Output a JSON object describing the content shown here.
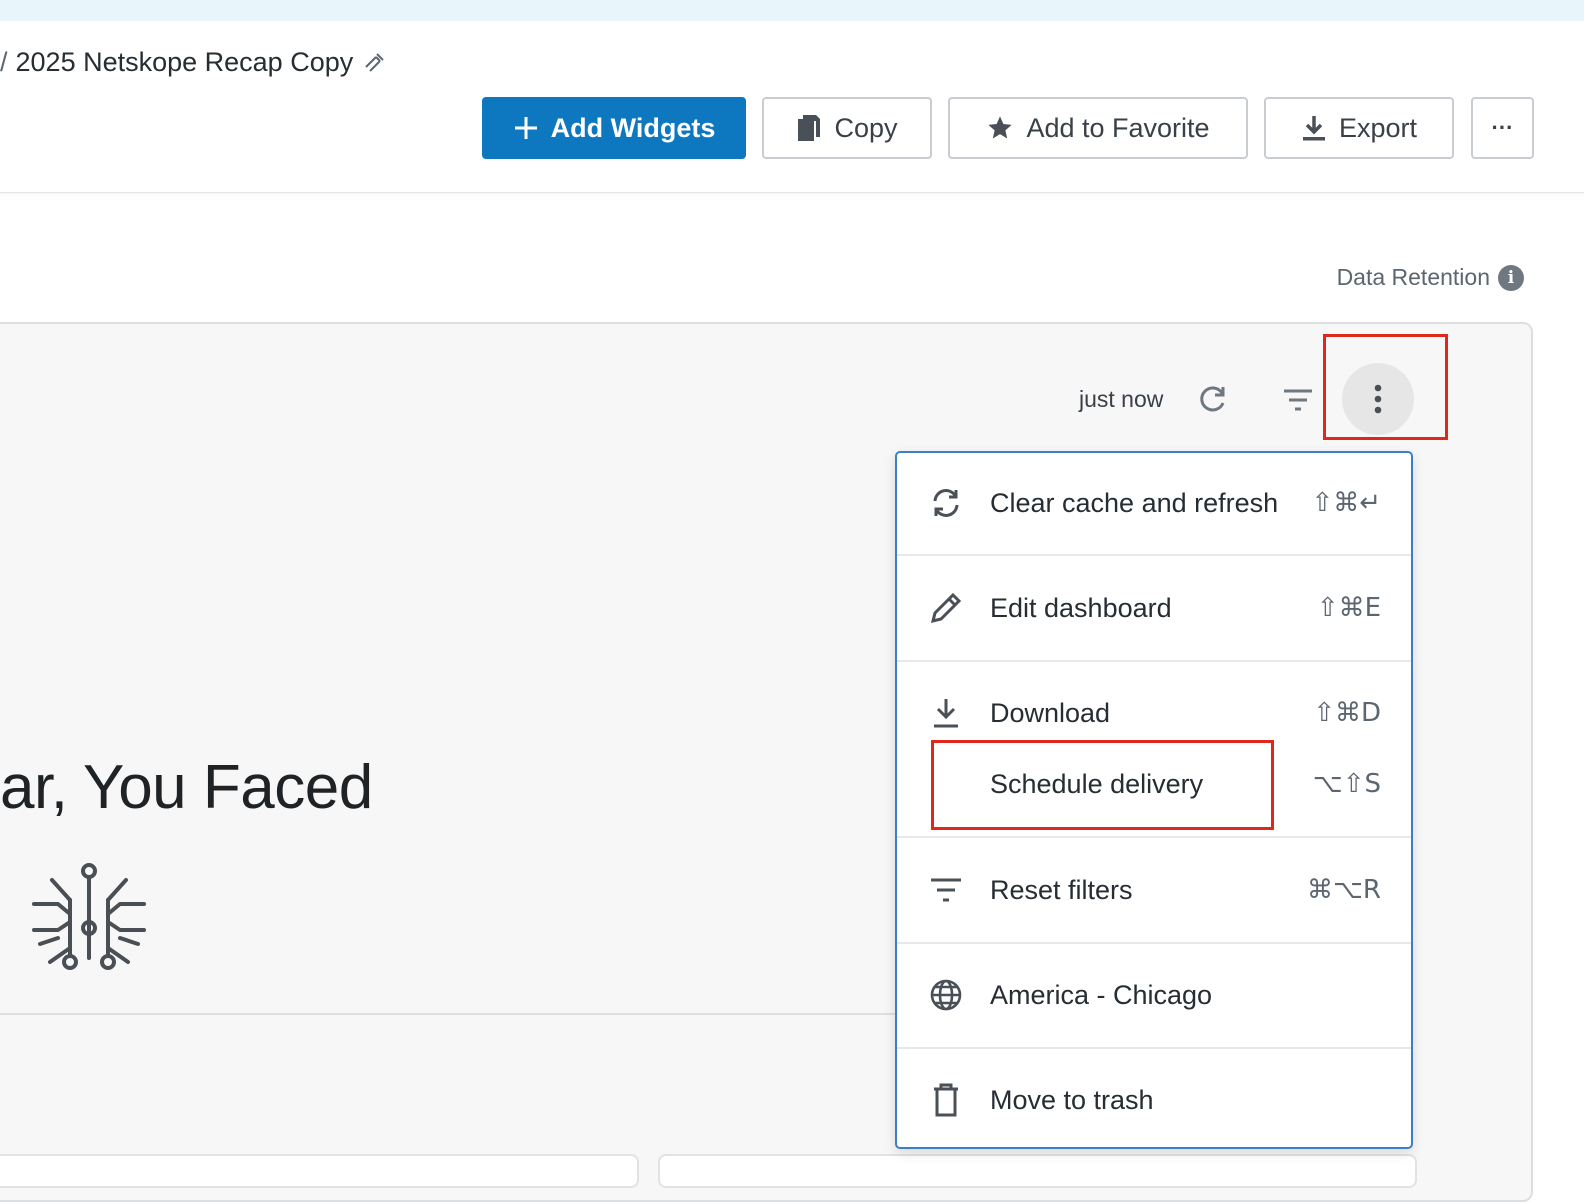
{
  "breadcrumb": {
    "separator": "/",
    "title": "2025 Netskope Recap Copy"
  },
  "toolbar": {
    "add_widgets": "Add Widgets",
    "copy": "Copy",
    "add_to_favorite": "Add to Favorite",
    "export": "Export",
    "more": "···"
  },
  "data_retention": {
    "label": "Data Retention",
    "info": "i"
  },
  "panel": {
    "refreshed": "just now",
    "headline": "ar, You Faced"
  },
  "menu": {
    "items": [
      {
        "label": "Clear cache and refresh",
        "shortcut": "⇧⌘↵",
        "icon": "sync-icon"
      },
      {
        "label": "Edit dashboard",
        "shortcut": "⇧⌘E",
        "icon": "pencil-icon"
      },
      {
        "label": "Download",
        "shortcut": "⇧⌘D",
        "icon": "download-icon"
      },
      {
        "label": "Schedule delivery",
        "shortcut": "⌥⇧S",
        "icon": ""
      },
      {
        "label": "Reset filters",
        "shortcut": "⌘⌥R",
        "icon": "filter-icon"
      },
      {
        "label": "America - Chicago",
        "shortcut": "",
        "icon": "globe-icon"
      },
      {
        "label": "Move to trash",
        "shortcut": "",
        "icon": "trash-icon"
      }
    ]
  },
  "colors": {
    "primary": "#0d78bf",
    "highlight": "#e0271e",
    "menu_border": "#3c7fc4"
  }
}
